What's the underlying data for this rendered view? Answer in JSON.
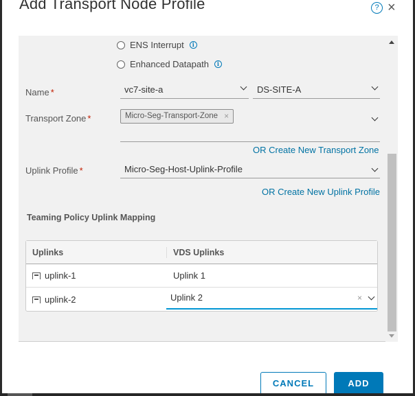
{
  "dialog": {
    "title": "Add Transport Node Profile",
    "help_icon": "?",
    "close_icon": "×"
  },
  "mode_options": [
    {
      "label": "ENS Interrupt",
      "selected": false,
      "info_icon": "i"
    },
    {
      "label": "Enhanced Datapath",
      "selected": false,
      "info_icon": "i"
    }
  ],
  "form": {
    "name": {
      "label": "Name",
      "required_mark": "*",
      "vcenter_value": "vc7-site-a",
      "switch_value": "DS-SITE-A"
    },
    "transport_zone": {
      "label": "Transport Zone",
      "required_mark": "*",
      "tags": [
        {
          "label": "Micro-Seg-Transport-Zone",
          "remove_icon": "×"
        }
      ],
      "create_link": "OR Create New Transport Zone"
    },
    "uplink_profile": {
      "label": "Uplink Profile",
      "required_mark": "*",
      "value": "Micro-Seg-Host-Uplink-Profile",
      "create_link": "OR Create New Uplink Profile"
    }
  },
  "teaming": {
    "title": "Teaming Policy Uplink Mapping",
    "columns": [
      "Uplinks",
      "VDS Uplinks"
    ],
    "rows": [
      {
        "uplink": "uplink-1",
        "vds_uplink": "Uplink 1",
        "editing": false
      },
      {
        "uplink": "uplink-2",
        "vds_uplink": "Uplink 2",
        "editing": true,
        "clear_icon": "×"
      }
    ]
  },
  "footer": {
    "cancel_label": "CANCEL",
    "add_label": "ADD"
  },
  "colors": {
    "accent": "#0079b8",
    "focus_underline": "#0095d3",
    "required": "#c21d00",
    "panel_bg": "#f1f1f1"
  }
}
